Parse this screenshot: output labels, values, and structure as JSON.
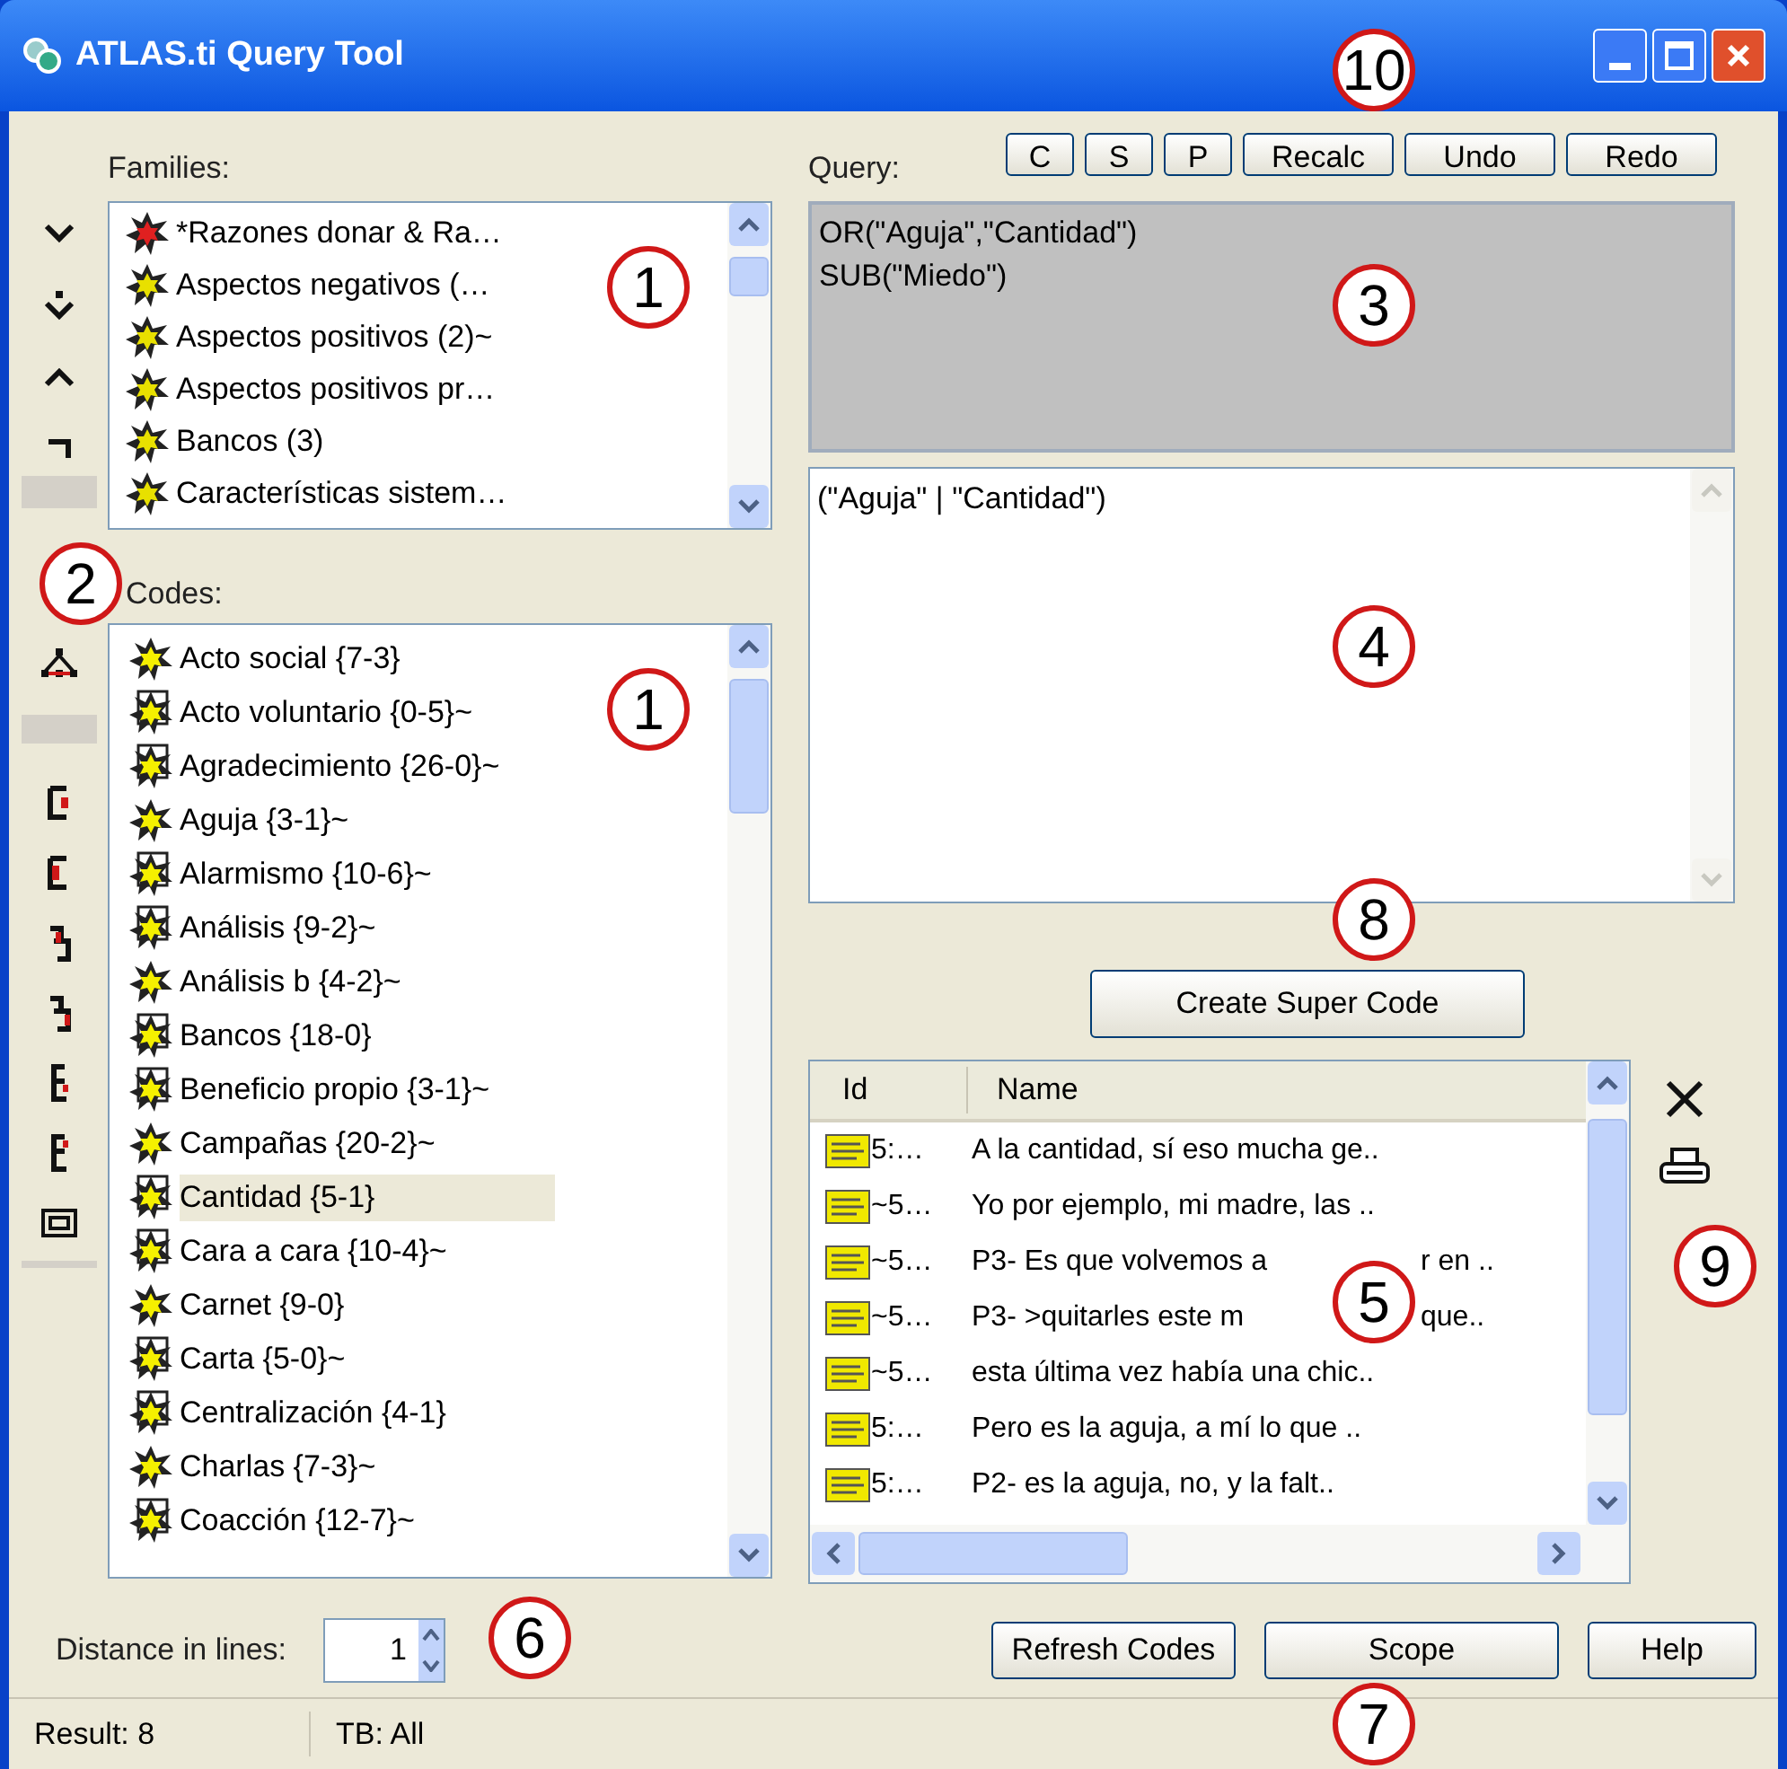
{
  "window": {
    "title": "ATLAS.ti Query Tool"
  },
  "families": {
    "label": "Families:",
    "items": [
      {
        "name": "*Razones donar & Ra…",
        "color": "#e02020"
      },
      {
        "name": "Aspectos negativos (…",
        "color": "#e8e000"
      },
      {
        "name": "Aspectos positivos (2)~",
        "color": "#e8e000"
      },
      {
        "name": "Aspectos positivos pr…",
        "color": "#e8e000"
      },
      {
        "name": "Bancos (3)",
        "color": "#e8e000"
      },
      {
        "name": "Características sistem…",
        "color": "#e8e000"
      }
    ]
  },
  "codes": {
    "label": "Codes:",
    "items": [
      {
        "name": "Acto social {7-3}",
        "selected": false
      },
      {
        "name": "Acto voluntario {0-5}~",
        "selected": false
      },
      {
        "name": "Agradecimiento {26-0}~",
        "selected": false
      },
      {
        "name": "Aguja {3-1}~",
        "selected": false
      },
      {
        "name": "Alarmismo {10-6}~",
        "selected": false
      },
      {
        "name": "Análisis {9-2}~",
        "selected": false
      },
      {
        "name": "Análisis b {4-2}~",
        "selected": false
      },
      {
        "name": "Bancos {18-0}",
        "selected": false
      },
      {
        "name": "Beneficio propio {3-1}~",
        "selected": false
      },
      {
        "name": "Campañas {20-2}~",
        "selected": false
      },
      {
        "name": "Cantidad {5-1}",
        "selected": true
      },
      {
        "name": "Cara a cara {10-4}~",
        "selected": false
      },
      {
        "name": "Carnet {9-0}",
        "selected": false
      },
      {
        "name": "Carta {5-0}~",
        "selected": false
      },
      {
        "name": "Centralización {4-1}",
        "selected": false
      },
      {
        "name": "Charlas {7-3}~",
        "selected": false
      },
      {
        "name": "Coacción {12-7}~",
        "selected": false
      }
    ]
  },
  "query": {
    "label": "Query:",
    "buttons": [
      "C",
      "S",
      "P",
      "Recalc",
      "Undo",
      "Redo"
    ],
    "lines": [
      "OR(\"Aguja\",\"Cantidad\")",
      "SUB(\"Miedo\")"
    ]
  },
  "expression": "(\"Aguja\" | \"Cantidad\")",
  "create_button": "Create Super Code",
  "results": {
    "columns": [
      "Id",
      "Name"
    ],
    "rows": [
      {
        "id": "5:…",
        "name": "A la cantidad, sí eso mucha ge.."
      },
      {
        "id": "~5…",
        "name": "Yo por ejemplo, mi madre, las .."
      },
      {
        "id": "~5…",
        "name": "P3- Es que volvemos a",
        "name_after_callout": "r en .."
      },
      {
        "id": "~5…",
        "name": "P3- >quitarles este m",
        "name_after_callout": "que.."
      },
      {
        "id": "~5…",
        "name": "esta última vez había una chic.."
      },
      {
        "id": "5:…",
        "name": "Pero es la aguja, a mí lo que .."
      },
      {
        "id": "5:…",
        "name": "P2- es la aguja, no, y la falt.."
      }
    ]
  },
  "distance": {
    "label": "Distance in lines:",
    "value": "1"
  },
  "bottom_buttons": [
    "Refresh Codes",
    "Scope",
    "Help"
  ],
  "status_bar": [
    "Result: 8",
    "TB: All"
  ],
  "callouts": [
    "10",
    "1",
    "2",
    "1",
    "3",
    "4",
    "8",
    "5",
    "9",
    "6",
    "7"
  ]
}
